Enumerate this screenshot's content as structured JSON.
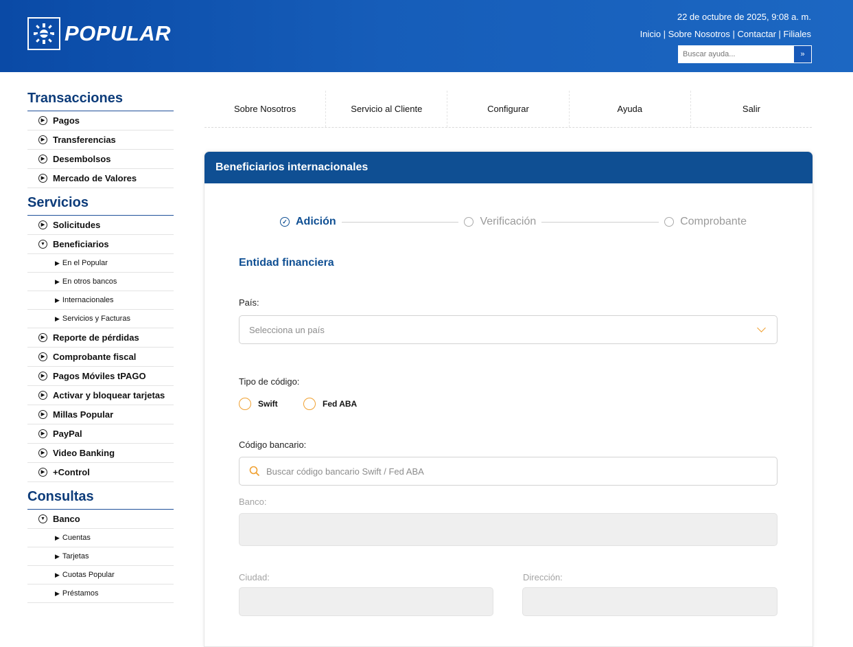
{
  "header": {
    "logo_text": "POPULAR",
    "date": "22 de octubre de 2025, 9:08 a. m.",
    "links": [
      "Inicio",
      "Sobre Nosotros",
      "Contactar",
      "Filiales"
    ],
    "search_placeholder": "Buscar ayuda...",
    "search_button": "»"
  },
  "sidebar": {
    "sections": [
      {
        "title": "Transacciones"
      },
      {
        "title": "Servicios"
      },
      {
        "title": "Consultas"
      }
    ],
    "transacciones": [
      "Pagos",
      "Transferencias",
      "Desembolsos",
      "Mercado de Valores"
    ],
    "servicios": {
      "solicitudes": "Solicitudes",
      "beneficiarios": "Beneficiarios",
      "beneficiarios_sub": [
        "En el Popular",
        "En otros bancos",
        "Internacionales",
        "Servicios y Facturas"
      ],
      "rest": [
        "Reporte de pérdidas",
        "Comprobante fiscal",
        "Pagos Móviles tPAGO",
        "Activar y bloquear tarjetas",
        "Millas Popular",
        "PayPal",
        "Video Banking",
        "+Control"
      ]
    },
    "consultas": {
      "banco": "Banco",
      "banco_sub": [
        "Cuentas",
        "Tarjetas",
        "Cuotas Popular",
        "Préstamos"
      ]
    }
  },
  "topnav": [
    "Sobre Nosotros",
    "Servicio al Cliente",
    "Configurar",
    "Ayuda",
    "Salir"
  ],
  "panel": {
    "title": "Beneficiarios internacionales",
    "steps": [
      "Adición",
      "Verificación",
      "Comprobante"
    ],
    "section_heading": "Entidad financiera",
    "pais_label": "País:",
    "pais_placeholder": "Selecciona un país",
    "tipo_label": "Tipo de código:",
    "tipo_options": [
      "Swift",
      "Fed ABA"
    ],
    "codigo_label": "Código bancario:",
    "codigo_placeholder": "Buscar código bancario Swift / Fed ABA",
    "banco_label": "Banco:",
    "ciudad_label": "Ciudad:",
    "direccion_label": "Dirección:"
  },
  "colors": {
    "header_blue": "#165db9",
    "panel_head": "#0f4f93",
    "accent_orange": "#f0a030"
  }
}
